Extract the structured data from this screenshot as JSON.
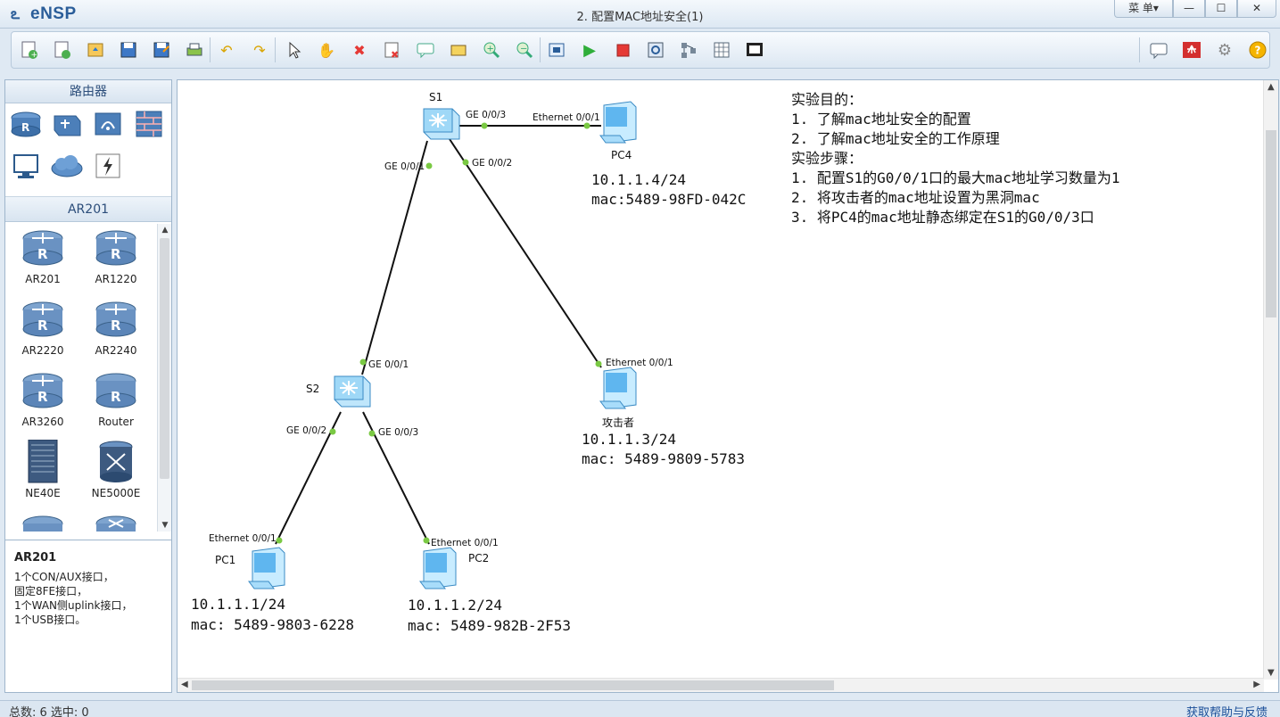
{
  "app": {
    "name": "eNSP",
    "title": "2. 配置MAC地址安全(1)"
  },
  "window_controls": {
    "menu": "菜 单▾",
    "minimize": "—",
    "maximize": "☐",
    "close": "✕"
  },
  "colors": {
    "link_green": "#7ac943",
    "accent_blue": "#2a5d99",
    "status_link": "#1b4f99"
  },
  "toolbar_icons": [
    "new-topology-icon",
    "new-device-icon",
    "open-icon",
    "save-icon",
    "save-as-icon",
    "print-icon",
    "undo-icon",
    "redo-icon",
    "select-icon",
    "pan-icon",
    "delete-icon",
    "delete-link-icon",
    "text-note-icon",
    "rectangle-icon",
    "zoom-in-icon",
    "zoom-out-icon",
    "fit-icon",
    "start-icon",
    "stop-icon",
    "capture-icon",
    "topology-icon",
    "grid-icon",
    "screenshot-icon",
    "message-icon",
    "huawei-icon",
    "settings-icon",
    "help-icon"
  ],
  "left_panel": {
    "category_title": "路由器",
    "device_section_title": "AR201",
    "devices": [
      {
        "label": "AR201"
      },
      {
        "label": "AR1220"
      },
      {
        "label": "AR2220"
      },
      {
        "label": "AR2240"
      },
      {
        "label": "AR3260"
      },
      {
        "label": "Router"
      },
      {
        "label": "NE40E"
      },
      {
        "label": "NE5000E"
      }
    ],
    "info": {
      "title": "AR201",
      "lines": [
        "1个CON/AUX接口，",
        "固定8FE接口，",
        "1个WAN侧uplink接口，",
        "1个USB接口。"
      ]
    }
  },
  "topology": {
    "devices": {
      "s1": "S1",
      "s2": "S2",
      "pc4": "PC4",
      "attacker": "攻击者",
      "pc1": "PC1",
      "pc2": "PC2"
    },
    "ports": {
      "s1_g3": "GE 0/0/3",
      "pc4_e1": "Ethernet 0/0/1",
      "s1_g1": "GE 0/0/1",
      "s1_g2": "GE 0/0/2",
      "s2_g1": "GE 0/0/1",
      "attacker_e1": "Ethernet 0/0/1",
      "s2_g2": "GE 0/0/2",
      "s2_g3": "GE 0/0/3",
      "pc1_e1": "Ethernet 0/0/1",
      "pc2_e1": "Ethernet 0/0/1"
    },
    "addresses": {
      "pc4_ip": "10.1.1.4/24",
      "pc4_mac": "mac:5489-98FD-042C",
      "attacker_ip": "10.1.1.3/24",
      "attacker_mac": "mac: 5489-9809-5783",
      "pc1_ip": "10.1.1.1/24",
      "pc1_mac": "mac: 5489-9803-6228",
      "pc2_ip": "10.1.1.2/24",
      "pc2_mac": "mac: 5489-982B-2F53"
    },
    "notes": [
      "实验目的：",
      "1. 了解mac地址安全的配置",
      "2. 了解mac地址安全的工作原理",
      "实验步骤：",
      "1. 配置S1的G0/0/1口的最大mac地址学习数量为1",
      "2. 将攻击者的mac地址设置为黑洞mac",
      "3. 将PC4的mac地址静态绑定在S1的G0/0/3口"
    ]
  },
  "status": {
    "left": "总数: 6  选中: 0",
    "right": "获取帮助与反馈"
  }
}
